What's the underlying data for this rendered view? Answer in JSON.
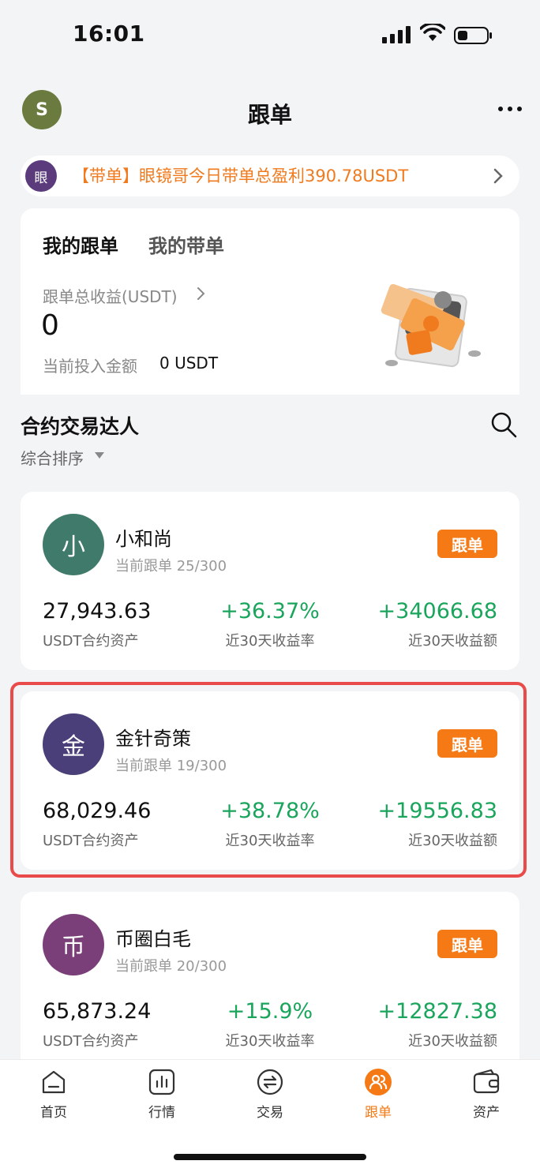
{
  "status_bar": {
    "time": "16:01"
  },
  "header": {
    "avatar_letter": "S",
    "title": "跟单"
  },
  "notice": {
    "avatar_text": "眼",
    "text": "【带单】眼镜哥今日带单总盈利390.78USDT"
  },
  "my_card": {
    "tabs": [
      "我的跟单",
      "我的带单"
    ],
    "earnings_label": "跟单总收益(USDT)",
    "earnings_value": "0",
    "invest_label": "当前投入金额",
    "invest_value": "0 USDT"
  },
  "section": {
    "title": "合约交易达人",
    "sort_label": "综合排序"
  },
  "traders": [
    {
      "avatar": "小",
      "name": "小和尚",
      "follow": "当前跟单 25/300",
      "button": "跟单",
      "asset": "27,943.63",
      "asset_label": "USDT合约资产",
      "rate": "+36.37%",
      "rate_label": "近30天收益率",
      "amount": "+34066.68",
      "amount_label": "近30天收益额",
      "avatar_color": "#3f7a6a"
    },
    {
      "avatar": "金",
      "name": "金针奇策",
      "follow": "当前跟单 19/300",
      "button": "跟单",
      "asset": "68,029.46",
      "asset_label": "USDT合约资产",
      "rate": "+38.78%",
      "rate_label": "近30天收益率",
      "amount": "+19556.83",
      "amount_label": "近30天收益额",
      "avatar_color": "#4a3f78"
    },
    {
      "avatar": "币",
      "name": "币圈白毛",
      "follow": "当前跟单 20/300",
      "button": "跟单",
      "asset": "65,873.24",
      "asset_label": "USDT合约资产",
      "rate": "+15.9%",
      "rate_label": "近30天收益率",
      "amount": "+12827.38",
      "amount_label": "近30天收益额",
      "avatar_color": "#7a3f78"
    }
  ],
  "nav": [
    {
      "label": "首页",
      "icon": "home-icon"
    },
    {
      "label": "行情",
      "icon": "chart-icon"
    },
    {
      "label": "交易",
      "icon": "swap-icon"
    },
    {
      "label": "跟单",
      "icon": "follow-icon",
      "active": true
    },
    {
      "label": "资产",
      "icon": "wallet-icon"
    }
  ],
  "colors": {
    "accent": "#f57a16",
    "positive": "#1aa55c",
    "highlight": "#e94b4b"
  }
}
